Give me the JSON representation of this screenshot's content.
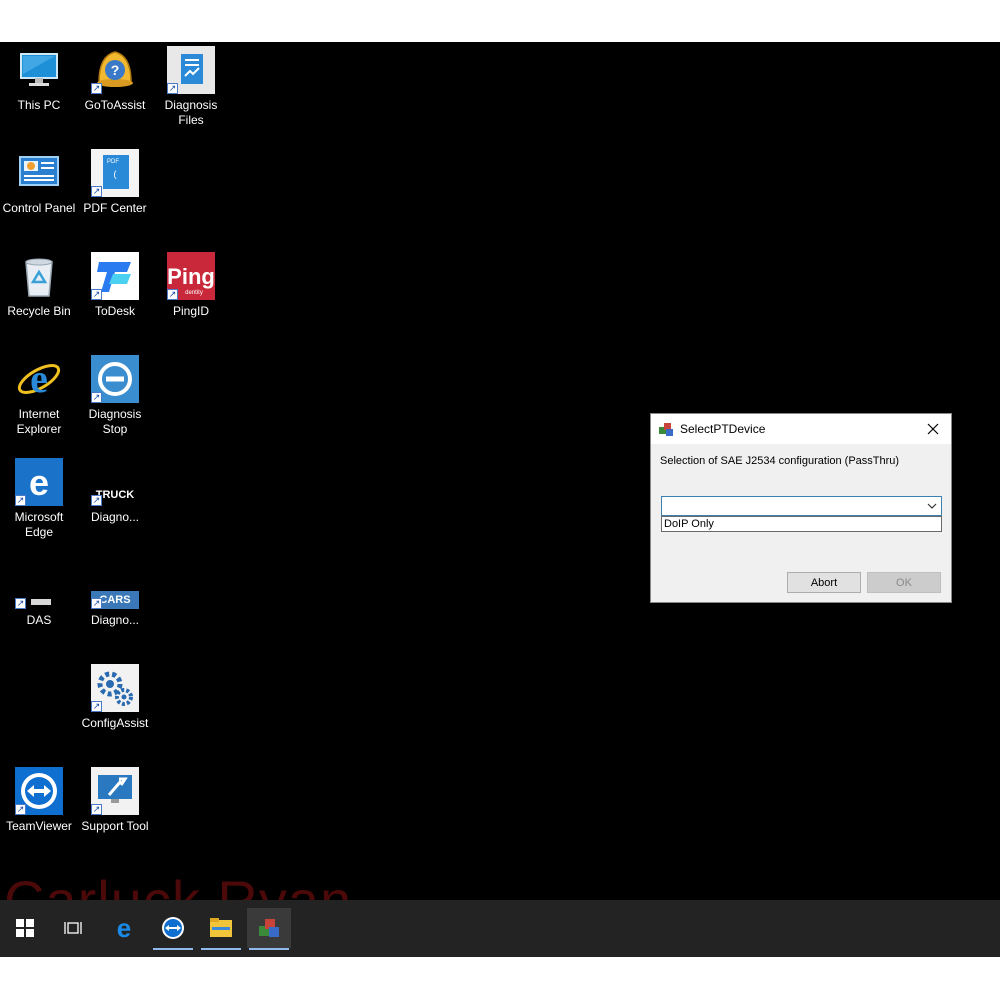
{
  "desktop": {
    "icons": [
      {
        "key": "this_pc",
        "label": "This PC"
      },
      {
        "key": "gotoassist",
        "label": "GoToAssist"
      },
      {
        "key": "diagnosis_files",
        "label": "Diagnosis Files"
      },
      {
        "key": "control_panel",
        "label": "Control Panel"
      },
      {
        "key": "pdf_center",
        "label": "PDF Center"
      },
      {
        "key": "recycle_bin",
        "label": "Recycle Bin"
      },
      {
        "key": "todesk",
        "label": "ToDesk"
      },
      {
        "key": "pingid",
        "label": "PingID"
      },
      {
        "key": "internet_explorer",
        "label": "Internet Explorer"
      },
      {
        "key": "diagnosis_stop",
        "label": "Diagnosis Stop"
      },
      {
        "key": "microsoft_edge",
        "label": "Microsoft Edge"
      },
      {
        "key": "diagnosis_truck",
        "label": "Diagno..."
      },
      {
        "key": "das",
        "label": "DAS"
      },
      {
        "key": "diagnosis_cars",
        "label": "Diagno..."
      },
      {
        "key": "configassist",
        "label": "ConfigAssist"
      },
      {
        "key": "teamviewer",
        "label": "TeamViewer"
      },
      {
        "key": "support_tool",
        "label": "Support Tool"
      }
    ],
    "icon_text": {
      "ping": "Ping",
      "ping_sub": "dentity",
      "truck": "TRUCK",
      "cars": "CARS",
      "pdf": "PDF"
    },
    "watermark": "Carluck Ryan"
  },
  "taskbar": {
    "items": [
      {
        "icon": "windows-start-icon",
        "active": false
      },
      {
        "icon": "task-view-icon",
        "active": false
      },
      {
        "icon": "edge-icon",
        "active": false
      },
      {
        "icon": "teamviewer-icon",
        "active": true
      },
      {
        "icon": "file-explorer-icon",
        "active": true
      },
      {
        "icon": "xentry-app-icon",
        "active": true
      }
    ]
  },
  "dialog": {
    "title": "SelectPTDevice",
    "description": "Selection of SAE J2534 configuration (PassThru)",
    "combo_value": "",
    "dropdown_option": "DoIP Only",
    "abort_label": "Abort",
    "ok_label": "OK"
  },
  "colors": {
    "desktop_bg": "#000000",
    "taskbar_bg": "#232323",
    "accent": "#3c7fb1"
  }
}
